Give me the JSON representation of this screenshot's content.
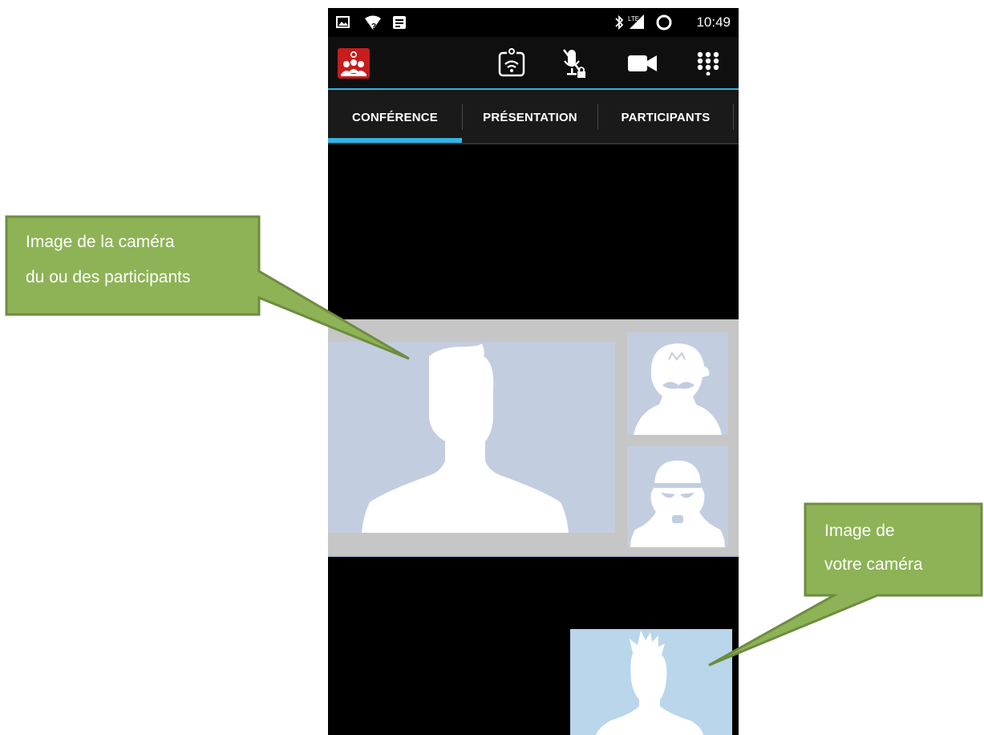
{
  "status_bar": {
    "time": "10:49",
    "icons": [
      "image-notification-icon",
      "wifi-unknown-icon",
      "message-notification-icon",
      "bluetooth-icon",
      "lte-signal-icon",
      "sync-icon"
    ]
  },
  "action_bar": {
    "app_icon": "conference-app-icon",
    "actions": [
      {
        "name": "wifi-share-icon"
      },
      {
        "name": "microphone-muted-icon"
      },
      {
        "name": "video-camera-icon"
      },
      {
        "name": "dialpad-grid-icon"
      }
    ],
    "accent_color": "#33b5e5"
  },
  "tabs": [
    {
      "label": "CONFÉRENCE",
      "selected": true
    },
    {
      "label": "PRÉSENTATION",
      "selected": false
    },
    {
      "label": "PARTICIPANTS",
      "selected": false
    }
  ],
  "video": {
    "main_participant": "person-silhouette",
    "thumbnails": [
      "mario-silhouette",
      "stormtrooper-silhouette"
    ],
    "self_view": "person-spiky-hair-silhouette"
  },
  "callouts": {
    "participants": {
      "line1": "Image de la caméra",
      "line2": "du ou des participants"
    },
    "self": {
      "line1": "Image de",
      "line2": "votre caméra"
    },
    "fill_color": "#8db356",
    "border_color": "#6e8c3f"
  }
}
